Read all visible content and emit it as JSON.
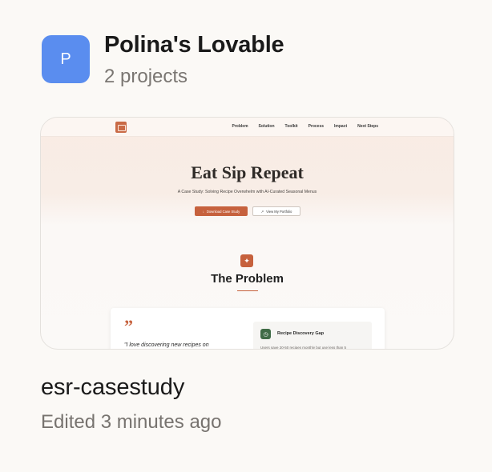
{
  "workspace": {
    "avatar_letter": "P",
    "name": "Polina's Lovable",
    "project_count": "2 projects",
    "avatar_color": "#5a8def"
  },
  "project": {
    "name": "esr-casestudy",
    "edited": "Edited 3 minutes ago",
    "thumbnail": {
      "nav_links": [
        "Problem",
        "Solution",
        "Toolkit",
        "Process",
        "Impact",
        "Next Steps"
      ],
      "title": "Eat Sip Repeat",
      "subtitle": "A Case Study: Solving Recipe Overwhelm with AI-Curated Seasonal Menus",
      "primary_button": "Download Case Study",
      "secondary_button": "View My Portfolio",
      "section_title": "The Problem",
      "quote_mark": "”",
      "quote": "\"I love discovering new recipes on",
      "card_title": "Recipe Discovery Gap",
      "card_text": "Users save 20-50 recipes monthly but use less than 5",
      "accent_color": "#c6613d",
      "icons": {
        "logo": "logo-icon",
        "download": "download-icon",
        "portfolio": "external-link-icon",
        "section": "sparkle-icon",
        "card": "clock-icon"
      }
    }
  }
}
